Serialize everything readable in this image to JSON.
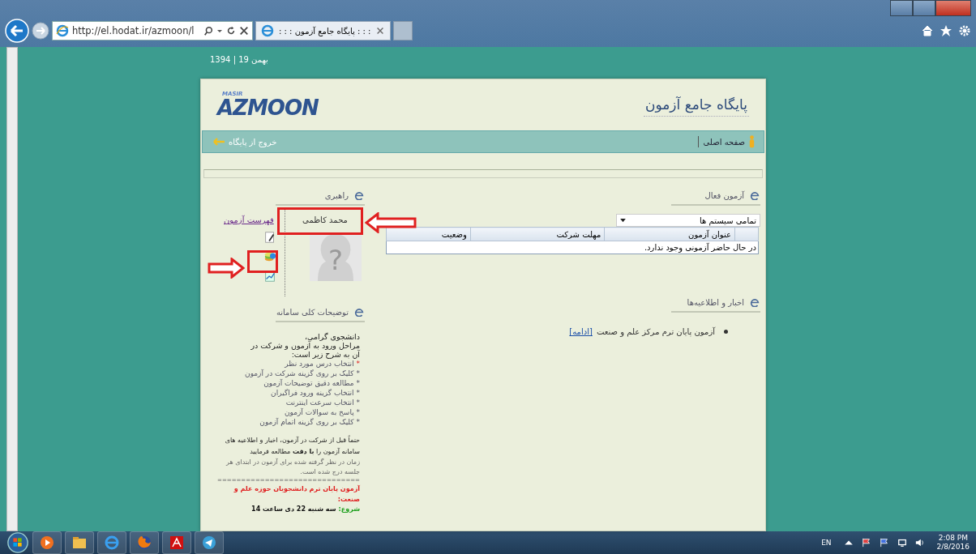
{
  "browser": {
    "address": "http://el.hodat.ir/azmoon/l",
    "tab_title": ": : : پایگاه جامع آزمون : : :"
  },
  "page": {
    "date": "1394 | 19 بهمن",
    "logo": {
      "small": "MASIR",
      "main": "AZMOON"
    },
    "site_title": "پایگاه جامع آزمون",
    "nav": {
      "home": "صفحه اصلی",
      "logout": "خروج از پایگاه"
    },
    "active_exams": {
      "heading": "آزمون فعال",
      "filter": "تمامی سیستم ها",
      "columns": [
        "عنوان آزمون",
        "مهلت شرکت",
        "وضعیت"
      ],
      "empty_message": "در حال حاضر آزمونی وجود ندارد."
    },
    "news": {
      "heading": "اخبار و اطلاعیه‌ها",
      "items": [
        {
          "text": "آزمون پایان ترم مرکز علم و صنعت",
          "link": "[ادامه]"
        }
      ]
    },
    "guide": {
      "heading": "راهبری",
      "user_name": "محمد کاظمی",
      "avatar_symbol": "?",
      "exam_list_link": "فهرست آزمون"
    },
    "description": {
      "heading": "توضیحات کلی سامانه",
      "greeting": "دانشجوی گرامی،",
      "intro": "مراحل ورود به آزمون و شرکت در آن به شرح زیر است:",
      "steps": [
        {
          "marker": "*",
          "text": "انتخاب درس مورد نظر",
          "highlight": true
        },
        {
          "marker": "*",
          "text": "کلیک بر روی گزینه شرکت در آزمون",
          "highlight": false
        },
        {
          "marker": "*",
          "text": "مطالعه دقیق توضیحات آزمون",
          "highlight": false
        },
        {
          "marker": "*",
          "text": "انتخاب گزینه ورود فراگیران",
          "highlight": false
        },
        {
          "marker": "*",
          "text": "انتخاب سرعت اینترنت",
          "highlight": false
        },
        {
          "marker": "*",
          "text": "پاسخ به سوالات آزمون",
          "highlight": false
        },
        {
          "marker": "*",
          "text": "کلیک بر روی گزینه اتمام آزمون",
          "highlight": false
        }
      ],
      "notice": "حتماً قبل از شرکت در آزمون، اخبار و اطلاعیه های سامانه آزمون را **با دقت** مطالعه فرمایید",
      "time_note": "زمان در نظر گرفته شده برای آزمون در ابتدای هر جلسه درج شده است.",
      "separator": "==============================",
      "exam_title": "آزمون پایان ترم دانشجویان حوزه علم و صنعت:",
      "start_label": "شروع:",
      "start_value": "سه شنبه 22 دی ساعت 14"
    }
  },
  "taskbar": {
    "language": "EN",
    "time": "2:08 PM",
    "date": "2/8/2016"
  }
}
